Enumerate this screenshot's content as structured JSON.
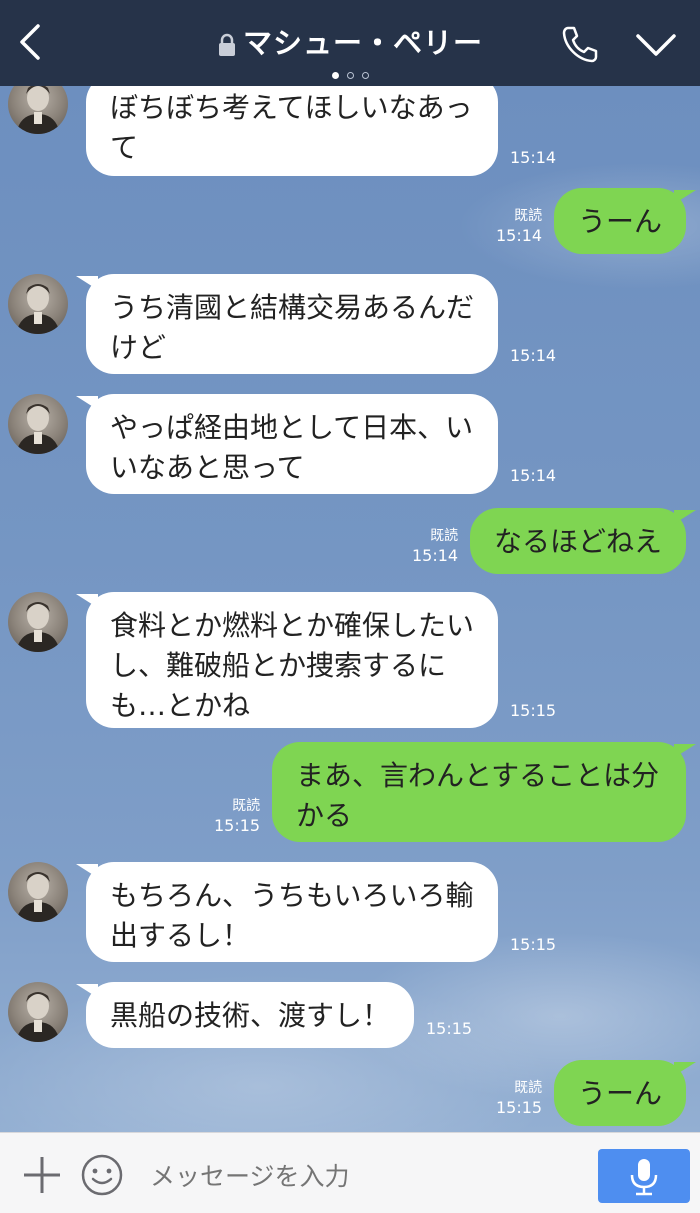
{
  "header": {
    "title": "マシュー・ペリー",
    "back_icon": "chevron-left-icon",
    "lock_icon": "lock-icon",
    "call_icon": "phone-icon",
    "menu_icon": "chevron-down-icon",
    "page_indicator": {
      "pages": 3,
      "active": 1
    }
  },
  "messages": [
    {
      "side": "in",
      "lines": [
        "ぼちぼち考えてほしいなあっ",
        "て"
      ],
      "time": "15:14"
    },
    {
      "side": "out",
      "text": "うーん",
      "read": "既読",
      "time": "15:14"
    },
    {
      "side": "in",
      "lines": [
        "うち清國と結構交易あるんだ",
        "けど"
      ],
      "time": "15:14"
    },
    {
      "side": "in",
      "lines": [
        "やっぱ経由地として日本、い",
        "いなあと思って"
      ],
      "time": "15:14"
    },
    {
      "side": "out",
      "text": "なるほどねえ",
      "read": "既読",
      "time": "15:14"
    },
    {
      "side": "in",
      "lines": [
        "食料とか燃料とか確保したい",
        "し、難破船とか捜索するに",
        "も…とかね"
      ],
      "time": "15:15"
    },
    {
      "side": "out",
      "lines": [
        "まあ、言わんとすることは分",
        "かる"
      ],
      "read": "既読",
      "time": "15:15"
    },
    {
      "side": "in",
      "lines": [
        "もちろん、うちもいろいろ輸",
        "出するし！"
      ],
      "time": "15:15"
    },
    {
      "side": "in",
      "text": "黒船の技術、渡すし！",
      "time": "15:15"
    },
    {
      "side": "out",
      "text": "うーん",
      "read": "既読",
      "time": "15:15"
    }
  ],
  "footer": {
    "placeholder": "メッセージを入力",
    "plus_icon": "plus-icon",
    "emoji_icon": "smiley-icon",
    "mic_icon": "microphone-icon"
  },
  "colors": {
    "header_bg": "#263349",
    "chat_bg": "#7596c3",
    "outgoing_bubble": "#7fd552",
    "incoming_bubble": "#ffffff",
    "mic_button": "#4e8ef0"
  }
}
